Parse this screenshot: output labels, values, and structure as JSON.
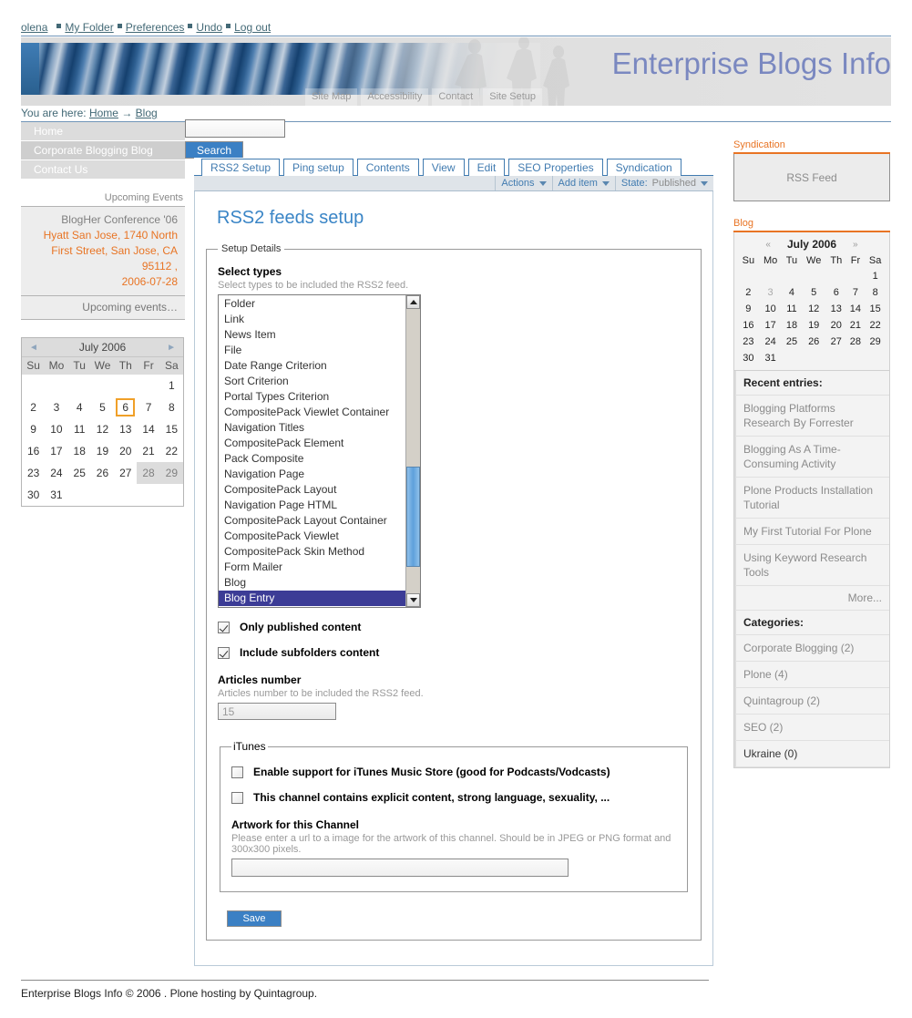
{
  "personalbar": {
    "user": "olena",
    "links": [
      "My Folder",
      "Preferences",
      "Undo",
      "Log out"
    ]
  },
  "header": {
    "site_title": "Enterprise Blogs Info",
    "title_color": "#7a88c0",
    "section_nav": [
      "Site Map",
      "Accessibility",
      "Contact",
      "Site Setup"
    ]
  },
  "breadcrumb": {
    "prefix": "You are here:",
    "home": "Home",
    "arrow": "→",
    "current": "Blog"
  },
  "search": {
    "value": "",
    "button_label": "Search"
  },
  "left": {
    "nav": [
      {
        "label": "Home",
        "selected": false
      },
      {
        "label": "Corporate Blogging Blog",
        "selected": true
      },
      {
        "label": "Contact Us",
        "selected": false
      }
    ],
    "events_portlet": {
      "title": "Upcoming Events",
      "event_title": "BlogHer Conference '06",
      "event_where": "Hyatt San Jose, 1740 North First Street, San Jose, CA 95112 ,",
      "event_when": "2006-07-28",
      "more": "Upcoming events…"
    },
    "calendar": {
      "month": "July 2006",
      "prev": "◄",
      "next": "►",
      "weekdays": [
        "Su",
        "Mo",
        "Tu",
        "We",
        "Th",
        "Fr",
        "Sa"
      ],
      "weeks": [
        [
          "",
          "",
          "",
          "",
          "",
          "",
          "1"
        ],
        [
          "2",
          "3",
          "4",
          "5",
          "6",
          "7",
          "8"
        ],
        [
          "9",
          "10",
          "11",
          "12",
          "13",
          "14",
          "15"
        ],
        [
          "16",
          "17",
          "18",
          "19",
          "20",
          "21",
          "22"
        ],
        [
          "23",
          "24",
          "25",
          "26",
          "27",
          "28",
          "29"
        ],
        [
          "30",
          "31",
          "",
          "",
          "",
          "",
          ""
        ]
      ],
      "today": "6",
      "event_days": [
        "28",
        "29"
      ]
    }
  },
  "tabs": [
    {
      "label": "RSS2 Setup",
      "selected": true
    },
    {
      "label": "Ping setup",
      "selected": false
    },
    {
      "label": "Contents",
      "selected": false
    },
    {
      "label": "View",
      "selected": false
    },
    {
      "label": "Edit",
      "selected": false
    },
    {
      "label": "SEO Properties",
      "selected": false
    },
    {
      "label": "Syndication",
      "selected": false
    }
  ],
  "content_actions": {
    "actions": "Actions",
    "add_item": "Add item",
    "state_label": "State:",
    "state_value": "Published"
  },
  "main": {
    "page_title": "RSS2 feeds setup",
    "fieldset_legend": "Setup Details",
    "select_types": {
      "label": "Select types",
      "help": "Select types to be included the RSS2 feed.",
      "options": [
        "Folder",
        "Link",
        "News Item",
        "File",
        "Date Range Criterion",
        "Sort Criterion",
        "Portal Types Criterion",
        "CompositePack Viewlet Container",
        "Navigation Titles",
        "CompositePack Element",
        "Pack Composite",
        "Navigation Page",
        "CompositePack Layout",
        "Navigation Page HTML",
        "CompositePack Layout Container",
        "CompositePack Viewlet",
        "CompositePack Skin Method",
        "Form Mailer",
        "Blog",
        "Blog Entry"
      ],
      "selected": "Blog Entry"
    },
    "only_published": {
      "label": "Only published content",
      "checked": true
    },
    "include_subfolders": {
      "label": "Include subfolders content",
      "checked": true
    },
    "articles_number": {
      "label": "Articles number",
      "help": "Articles number to be included the RSS2 feed.",
      "value": "15"
    },
    "itunes": {
      "legend": "iTunes",
      "enable_support": {
        "label": "Enable support for iTunes Music Store (good for Podcasts/Vodcasts)",
        "checked": false
      },
      "explicit": {
        "label": "This channel contains explicit content, strong language, sexuality, ...",
        "checked": false
      },
      "artwork": {
        "label": "Artwork for this Channel",
        "help": "Please enter a url to a image for the artwork of this channel. Should be in JPEG or PNG format and 300x300 pixels.",
        "value": ""
      }
    },
    "save_label": "Save"
  },
  "right": {
    "syndication": {
      "title": "Syndication",
      "rss_label": "RSS Feed"
    },
    "blog": {
      "title": "Blog",
      "calendar": {
        "month": "July 2006",
        "prev": "«",
        "next": "»",
        "weekdays": [
          "Su",
          "Mo",
          "Tu",
          "We",
          "Th",
          "Fr",
          "Sa"
        ],
        "weeks": [
          [
            "",
            "",
            "",
            "",
            "",
            "",
            "1"
          ],
          [
            "2",
            "3",
            "4",
            "5",
            "6",
            "7",
            "8"
          ],
          [
            "9",
            "10",
            "11",
            "12",
            "13",
            "14",
            "15"
          ],
          [
            "16",
            "17",
            "18",
            "19",
            "20",
            "21",
            "22"
          ],
          [
            "23",
            "24",
            "25",
            "26",
            "27",
            "28",
            "29"
          ],
          [
            "30",
            "31",
            "",
            "",
            "",
            "",
            ""
          ]
        ],
        "dim_days": [
          "3"
        ]
      },
      "recent_title": "Recent entries:",
      "recent": [
        "Blogging Platforms Research By Forrester",
        "Blogging As A Time-Consuming Activity",
        "Plone Products Installation Tutorial",
        "My First Tutorial For Plone",
        "Using Keyword Research Tools"
      ],
      "more": "More...",
      "categories_title": "Categories:",
      "categories": [
        "Corporate Blogging (2)",
        "Plone (4)",
        "Quintagroup (2)",
        "SEO (2)",
        "Ukraine (0)"
      ]
    }
  },
  "footer": {
    "text": "Enterprise Blogs Info © 2006 . Plone hosting by Quintagroup."
  }
}
